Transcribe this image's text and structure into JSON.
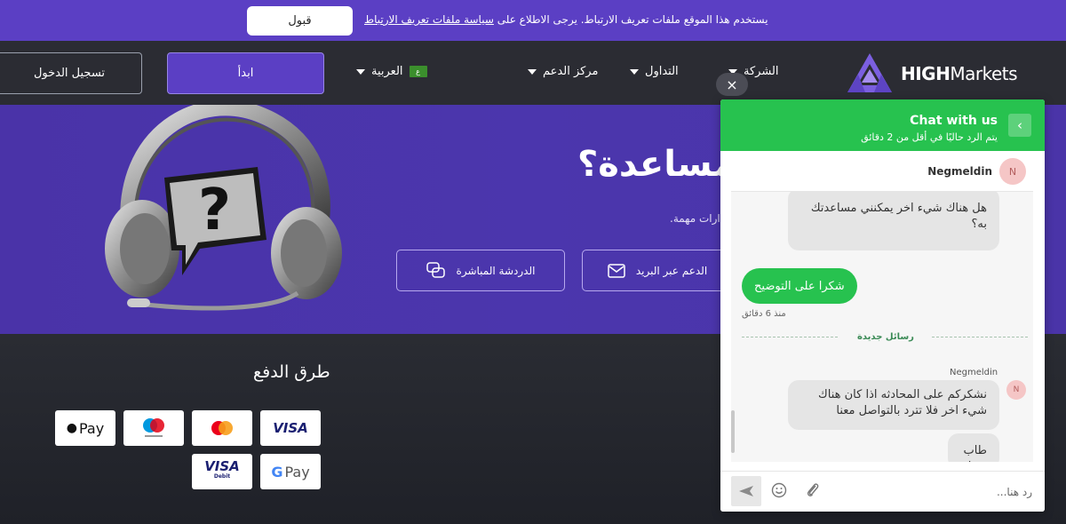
{
  "cookie": {
    "text": "يستخدم هذا الموقع ملفات تعريف الارتباط. يرجى الاطلاع على",
    "link": "سياسة ملفات تعريف الارتباط",
    "accept": "قبول"
  },
  "header": {
    "logo_bold": "HIGH",
    "logo_rest": "Markets",
    "nav": [
      "الشركة",
      "التداول",
      "مركز الدعم",
      "العربية"
    ],
    "language_flag": "ع",
    "start": "ابدأ",
    "login": "تسجيل الدخول"
  },
  "hero": {
    "title": "مساعدة؟",
    "subtitle": "ارات مهمة.",
    "email_btn": "الدعم عبر البريد",
    "chat_btn": "الدردشة المباشرة"
  },
  "payments": {
    "title": "طرق الدفع",
    "cards": [
      "VISA",
      "Mastercard",
      "Maestro",
      "Apple Pay",
      "Google Pay",
      "VISA Debit"
    ]
  },
  "chat": {
    "close": "×",
    "title": "Chat with us",
    "subtitle": "يتم الرد حاليًا في أقل من 2 دقائق",
    "agent_name": "Negmeldin",
    "agent_initial": "N",
    "msg1": "هل هناك شيء اخر يمكنني مساعدتك به؟",
    "msg_out": "شكرا على التوضيح",
    "msg_out_time": "منذ 6 دقائق",
    "new_messages": "رسائل جديدة",
    "sender": "Negmeldin",
    "msg2": "نشكركم على المحادثه اذا كان هناك شيء اخر فلا تترد بالتواصل معنا",
    "msg3": "طاب يومك",
    "input_placeholder": "رد هنا..."
  },
  "colors": {
    "brand_purple": "#5b3fc4",
    "chat_green": "#27c24f",
    "header_bg": "#2b2c33"
  }
}
